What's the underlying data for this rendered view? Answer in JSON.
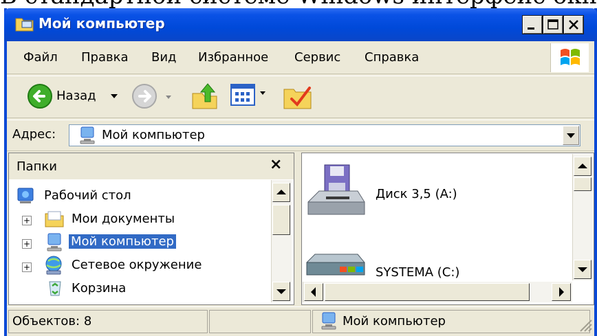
{
  "caption": "В стандартной системе Windows интерфейс окна",
  "window": {
    "title": "Мой компьютер",
    "controls": {
      "minimize": "_",
      "maximize": "□",
      "close": "×"
    }
  },
  "menu": [
    "Файл",
    "Правка",
    "Вид",
    "Избранное",
    "Сервис",
    "Справка"
  ],
  "toolbar": {
    "back_label": "Назад"
  },
  "address": {
    "label": "Адрес:",
    "value": "Мой компьютер"
  },
  "folders": {
    "title": "Папки",
    "close": "×",
    "tree": [
      {
        "label": "Рабочий стол",
        "icon": "desktop-icon"
      },
      {
        "label": "Мои документы",
        "icon": "folder-icon"
      },
      {
        "label": "Мой компьютер",
        "icon": "computer-icon",
        "selected": true
      },
      {
        "label": "Сетевое окружение",
        "icon": "network-icon"
      },
      {
        "label": "Корзина",
        "icon": "recycle-bin-icon"
      }
    ],
    "expander": "+"
  },
  "content": {
    "items": [
      {
        "label": "Диск 3,5 (A:)",
        "icon": "floppy-drive-icon"
      },
      {
        "label": "SYSTEMA (C:)",
        "icon": "hard-drive-icon"
      }
    ]
  },
  "status": {
    "objects": "Объектов: 8",
    "location": "Мой компьютер"
  },
  "colors": {
    "titlebar": "#0a52e6",
    "selection": "#316ac5",
    "chrome": "#ece9d8"
  }
}
